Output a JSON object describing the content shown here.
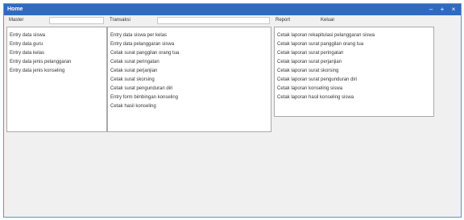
{
  "window": {
    "title": "Home"
  },
  "controls": {
    "minimize": "–",
    "maximize": "+",
    "close": "×"
  },
  "menu": {
    "master": "Master",
    "transaksi": "Transaksi",
    "report": "Report",
    "keluar": "Keluar"
  },
  "master_items": [
    "Entry data siswa",
    "Entry data guru",
    "Entry data kelas",
    "Entry data jenis pelanggaran",
    "Entry data jenis konseling"
  ],
  "transaksi_items": [
    "Entry data siswa per kelas",
    "Entry data pelanggaran siswa",
    "Cetak surat panggilan orang tua",
    "Cetak surat peringatan",
    "Cetak surat perjanjian",
    "Cetak surat skorsing",
    "Cetak surat pengunduran diri",
    "Entry form bimbingan konseling",
    "Cetak hasil konseling"
  ],
  "report_items": [
    "Cetak laporan rekapitulasi pelanggaran siswa",
    "Cetak laporan surat panggilan orang tua",
    "Cetak laporan surat peringatan",
    "Cetak laporan surat perjanjian",
    "Cetak laporan surat skorsing",
    "Cetak laporan surat pengunduran diri",
    "Cetak laporan konseling siswa",
    "Cetak laporan hasil konseling siswa"
  ]
}
